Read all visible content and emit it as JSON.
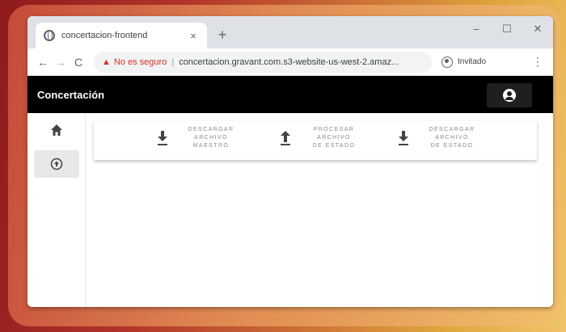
{
  "browser": {
    "tab_title": "concertacion-frontend",
    "tab_close": "×",
    "new_tab": "+",
    "minimize": "–",
    "maximize": "☐",
    "close": "✕",
    "back": "←",
    "forward": "→",
    "reload": "C",
    "warning_text": "No es seguro",
    "separator": "|",
    "url": "concertacion.gravant.com.s3-website-us-west-2.amaz...",
    "profile_label": "Invitado",
    "menu": "⋮"
  },
  "appbar": {
    "brand": "Concertación"
  },
  "sidebar": {
    "items": [
      {
        "name": "home",
        "glyph": "⌂"
      },
      {
        "name": "concertacion",
        "glyph": "↑"
      }
    ]
  },
  "toolbar": {
    "actions": [
      {
        "label": "DESCARGAR\nARCHIVO\nMAESTRO",
        "icon": "download-icon"
      },
      {
        "label": "PROCESAR\nARCHIVO\nDE ESTADO",
        "icon": "upload-icon"
      },
      {
        "label": "DESCARGAR\nARCHIVO\nDE ESTADO",
        "icon": "download-icon"
      }
    ]
  }
}
